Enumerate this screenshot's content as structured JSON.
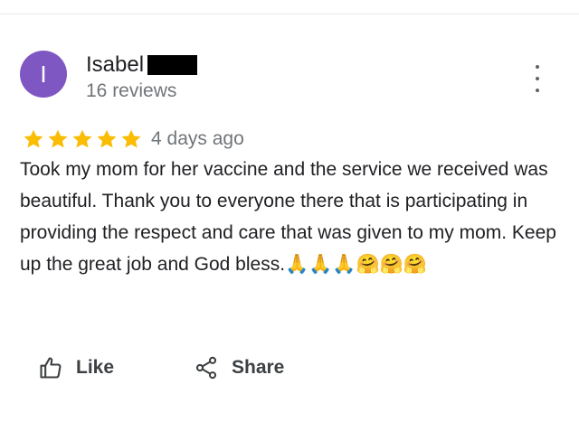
{
  "reviewer": {
    "avatar_initial": "I",
    "name": "Isabel",
    "review_count": "16 reviews"
  },
  "review": {
    "rating": 5,
    "max_rating": 5,
    "time": "4 days ago",
    "text": "Took my mom for her vaccine and the service we received was beautiful. Thank you to everyone there that is participating in providing the respect and care that was given to my mom. Keep up the great job and God bless.🙏🙏🙏🤗🤗🤗"
  },
  "actions": {
    "like_label": "Like",
    "share_label": "Share"
  },
  "icons": {
    "menu": "more-vert-icon",
    "star": "star-icon",
    "like": "thumb-up-icon",
    "share": "share-icon"
  },
  "colors": {
    "avatar_bg": "#7e57c2",
    "star": "#fbbc04",
    "secondary_text": "#70757a",
    "primary_text": "#202124"
  }
}
